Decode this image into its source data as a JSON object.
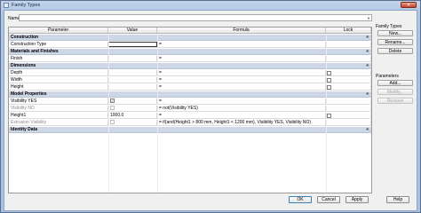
{
  "window": {
    "title": "Family Types"
  },
  "name_field": {
    "label": "Name:",
    "value": ""
  },
  "table": {
    "headers": {
      "parameter": "Parameter",
      "value": "Value",
      "formula": "Formula",
      "lock": "Lock"
    },
    "groups": [
      {
        "title": "Construction",
        "rows": [
          {
            "parameter": "Construction Type",
            "value": "",
            "formula": "=",
            "lock": false,
            "selected_value": true
          }
        ]
      },
      {
        "title": "Materials and Finishes",
        "rows": [
          {
            "parameter": "Finish",
            "value": "",
            "formula": "=",
            "lock": false
          }
        ]
      },
      {
        "title": "Dimensions",
        "rows": [
          {
            "parameter": "Depth",
            "value": "",
            "formula": "=",
            "lock": true
          },
          {
            "parameter": "Width",
            "value": "",
            "formula": "=",
            "lock": true
          },
          {
            "parameter": "Height",
            "value": "",
            "formula": "=",
            "lock": true
          }
        ]
      },
      {
        "title": "Model Properties",
        "rows": [
          {
            "parameter": "Visibility YES",
            "value": "checkbox_checked",
            "formula": "=",
            "lock": false
          },
          {
            "parameter": "Visibility NO",
            "value": "checkbox",
            "formula": "= not(Visibility YES)",
            "lock": false,
            "gray": true
          },
          {
            "parameter": "Height1",
            "value": "1000.0",
            "formula": "=",
            "lock": true
          },
          {
            "parameter": "Extrusion Visibility",
            "value": "checkbox",
            "formula": "= if(and(Height1 > 800 mm, Height1 < 1200 mm), Visibility YES, Visibility NO)",
            "lock": false,
            "gray": true
          }
        ]
      },
      {
        "title": "Identity Data",
        "rows": []
      }
    ]
  },
  "side": {
    "family_types_label": "Family Types",
    "new": "New...",
    "rename": "Rename...",
    "delete": "Delete",
    "parameters_label": "Parameters",
    "add": "Add...",
    "modify": "Modify...",
    "remove": "Remove"
  },
  "bottom": {
    "ok": "OK",
    "cancel": "Cancel",
    "apply": "Apply",
    "help": "Help"
  },
  "collapse_glyph": "«",
  "check_glyph": "✓"
}
